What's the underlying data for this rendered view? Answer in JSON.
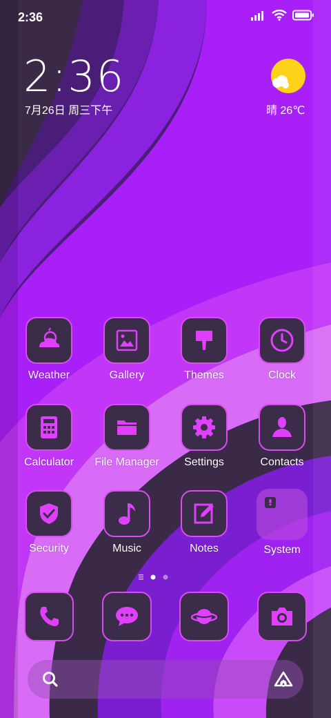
{
  "status_bar": {
    "time": "2:36"
  },
  "lockclock": {
    "time": "2:36",
    "date": "7月26日 周三下午"
  },
  "weather_widget": {
    "condition": "晴",
    "temperature": "26℃",
    "icon": "sun-cloud-icon"
  },
  "apps": [
    {
      "label": "Weather",
      "icon": "weather-icon"
    },
    {
      "label": "Gallery",
      "icon": "gallery-icon"
    },
    {
      "label": "Themes",
      "icon": "themes-icon"
    },
    {
      "label": "Clock",
      "icon": "clock-icon"
    },
    {
      "label": "Calculator",
      "icon": "calculator-icon"
    },
    {
      "label": "File Manager",
      "icon": "folder-icon"
    },
    {
      "label": "Settings",
      "icon": "gear-icon"
    },
    {
      "label": "Contacts",
      "icon": "contacts-icon"
    },
    {
      "label": "Security",
      "icon": "shield-icon"
    },
    {
      "label": "Music",
      "icon": "music-icon"
    },
    {
      "label": "Notes",
      "icon": "notes-icon"
    },
    {
      "label": "System",
      "icon": "system-folder-icon"
    }
  ],
  "page_indicator": {
    "pages": 2,
    "current": 1
  },
  "dock": [
    {
      "icon": "phone-icon"
    },
    {
      "icon": "messages-icon"
    },
    {
      "icon": "browser-icon"
    },
    {
      "icon": "camera-icon"
    }
  ],
  "search_bar": {
    "search_icon": "search-icon",
    "assistant_icon": "assistant-icon"
  },
  "colors": {
    "accent": "#e040fb",
    "tile_bg": "#3b2c4a",
    "tile_border": "#d94df0"
  }
}
